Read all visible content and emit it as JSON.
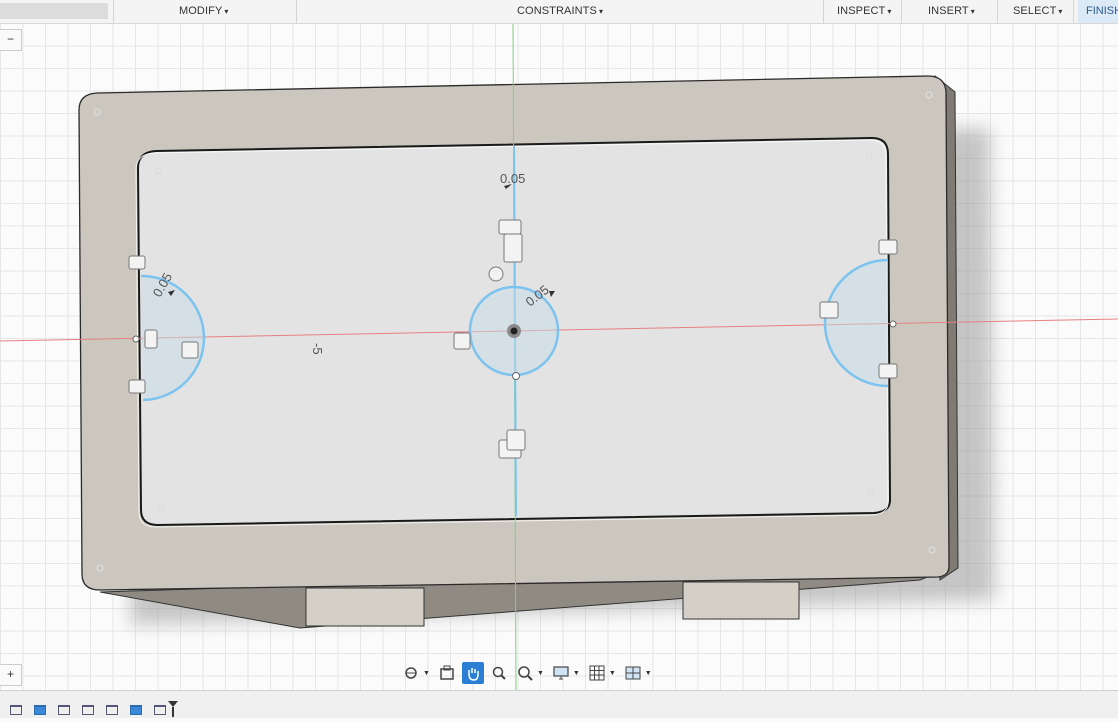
{
  "toolbar": {
    "menus": [
      {
        "label": "MODIFY",
        "caret": "▾"
      },
      {
        "label": "CONSTRAINTS",
        "caret": "▾"
      },
      {
        "label": "INSPECT",
        "caret": "▾"
      },
      {
        "label": "INSERT",
        "caret": "▾"
      },
      {
        "label": "SELECT",
        "caret": "▾"
      },
      {
        "label": "FINISH"
      }
    ]
  },
  "sketch": {
    "dim_top": "0.05",
    "dim_left": "0.05",
    "dim_center": "0.05",
    "dim_axis": "-5"
  },
  "side_controls": {
    "collapse_symbol": "−",
    "expand_symbol": "+"
  },
  "navbar": {
    "icons": [
      "orbit-icon",
      "look-at-icon",
      "pan-icon",
      "zoom-window-icon",
      "zoom-fit-icon",
      "display-settings-icon",
      "grid-snaps-icon",
      "viewports-icon"
    ],
    "active": "pan-icon"
  },
  "colors": {
    "body_face": "#c9c5bc",
    "body_side": "#8e8a80",
    "profile_fill": "#e3e4e5",
    "sketch_curve": "#7cc3ef",
    "axis_red": "#e07070",
    "axis_green": "#6cc36c",
    "accent": "#2a7fd4"
  }
}
